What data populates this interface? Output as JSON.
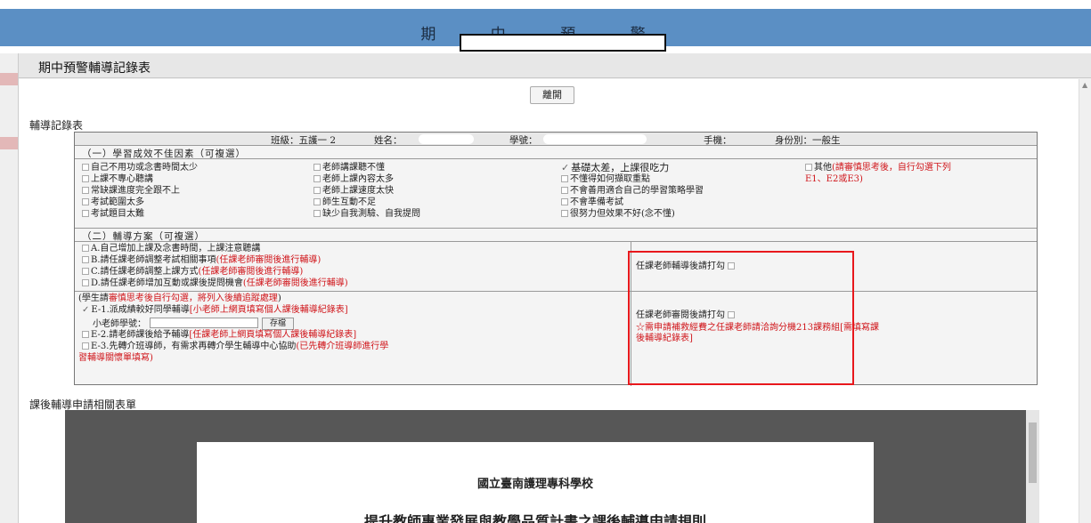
{
  "banner": {
    "title": "期 中 預 警"
  },
  "panel": {
    "title": "期中預警輔導記錄表",
    "leave_button": "離開"
  },
  "record": {
    "heading": "輔導記錄表",
    "student": {
      "class_label": "班級：五護一 2",
      "name_label": "姓名：",
      "id_label": "學號：",
      "phone_label": "手機：",
      "identity_label": "身份別：一般生"
    },
    "section1": {
      "title": "（一）學習成效不佳因素（可複選）",
      "col1": [
        "自己不用功或念書時間太少",
        "上課不專心聽講",
        "常缺課進度完全跟不上",
        "考試範圍太多",
        "考試題目太難"
      ],
      "col2": [
        "老師講課聽不懂",
        "老師上課內容太多",
        "老師上課速度太快",
        "師生互動不足",
        "缺少自我測驗、自我提問"
      ],
      "col3": [
        "基礎太差，上課很吃力",
        "不懂得如何擷取重點",
        "不會善用適合自己的學習策略學習",
        "不會準備考試",
        "很努力但效果不好(念不懂)"
      ],
      "col3_checked": 0,
      "other_label": "其他",
      "other_note_1": "(請審慎思考後，自行勾選下列",
      "other_note_2": "E1、E2或E3)"
    },
    "section2": {
      "title": "（二）輔導方案（可複選）",
      "a": "A.自己增加上課及念書時間，上課注意聽講",
      "b_text": "B.請任課老師調整考試相關事項",
      "b_note": "(任課老師審閱後進行輔導)",
      "c_text": "C.請任課老師調整上課方式",
      "c_note": "(任課老師審閱後進行輔導)",
      "d_text": "D.請任課老師增加互動或課後提問機會",
      "d_note": "(任課老師審閱後進行輔導)",
      "right_check": "任課老師輔導後請打勾"
    },
    "section3": {
      "intro_1": "(學生請",
      "intro_red": "審慎思考後自行勾選，將列入後續追蹤處理",
      "intro_2": ")",
      "e1_text": "E-1.派成績較好同學輔導",
      "e1_note": "[小老師上網頁填寫個人課後輔導紀錄表]",
      "tutor_label": "小老師學號：",
      "save_label": "存檔",
      "e2_text": "E-2.請老師課後給予輔導",
      "e2_note": "[任課老師上網頁填寫個人課後輔導紀錄表]",
      "e3_text": "E-3.先轉介班導師，有需求再轉介學生輔導中心協助",
      "e3_note_1": "(已先轉介班導師進行學",
      "e3_note_2": "習輔導關懷單填寫)",
      "right_check": "任課老師審閱後請打勾",
      "right_note_1": "☆需申請補救經費之任課老師請洽詢分機213課務組[需填寫課",
      "right_note_2": "後輔導紀錄表]"
    }
  },
  "forms": {
    "heading": "課後輔導申請相關表單",
    "doc_title_1": "國立臺南護理專科學校",
    "doc_title_2": "提升教師專業發展與教學品質計畫之課後輔導申請規則"
  }
}
